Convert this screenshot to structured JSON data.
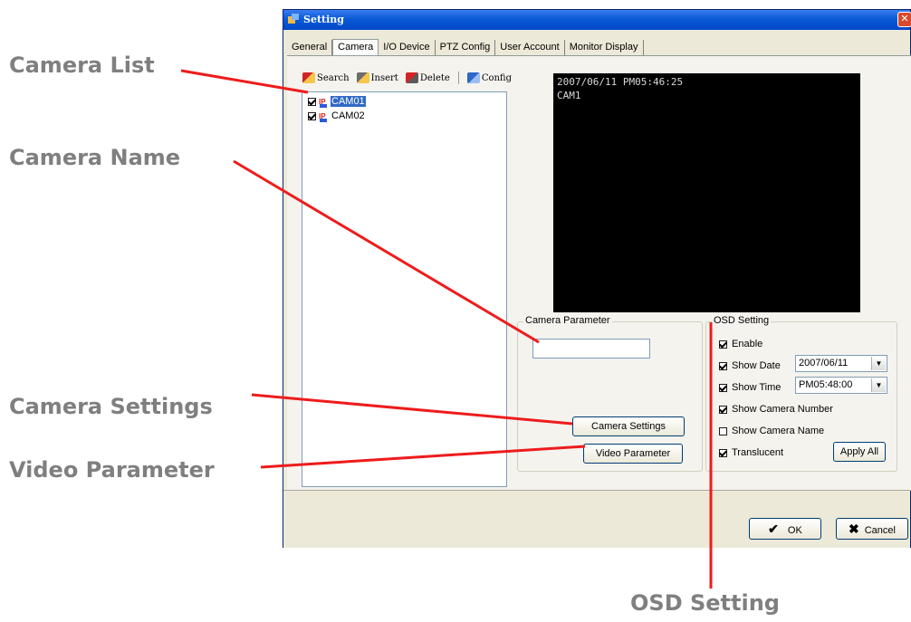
{
  "window": {
    "title": "Setting",
    "close_glyph": "✕",
    "tabs": [
      {
        "label": "General"
      },
      {
        "label": "Camera"
      },
      {
        "label": "I/O Device"
      },
      {
        "label": "PTZ Config"
      },
      {
        "label": "User Account"
      },
      {
        "label": "Monitor Display"
      }
    ],
    "active_tab": "Camera"
  },
  "toolbar": {
    "search_label": "Search",
    "insert_label": "Insert",
    "delete_label": "Delete",
    "config_label": "Config"
  },
  "camera_list": {
    "items": [
      {
        "name": "CAM01",
        "checked": true,
        "selected": true,
        "icon": "ip-camera-icon"
      },
      {
        "name": "CAM02",
        "checked": true,
        "selected": false,
        "icon": "ip-camera-icon"
      }
    ]
  },
  "preview": {
    "osd_line1": "2007/06/11 PM05:46:25",
    "osd_line2": "CAM1"
  },
  "camera_parameter": {
    "title": "Camera Parameter",
    "name_value": "",
    "camera_settings_label": "Camera Settings",
    "video_parameter_label": "Video Parameter"
  },
  "osd_setting": {
    "title": "OSD Setting",
    "enable_label": "Enable",
    "show_date_label": "Show Date",
    "date_value": "2007/06/11",
    "show_time_label": "Show Time",
    "time_value": "PM05:48:00",
    "show_camera_number_label": "Show Camera Number",
    "show_camera_name_label": "Show Camera Name",
    "translucent_label": "Translucent",
    "apply_all_label": "Apply All"
  },
  "dialog_buttons": {
    "ok_label": "OK",
    "cancel_label": "Cancel"
  },
  "annotations": {
    "camera_list": "Camera List",
    "camera_name": "Camera Name",
    "camera_settings": "Camera Settings",
    "video_parameter": "Video Parameter",
    "osd_setting": "OSD Setting"
  },
  "colors": {
    "callout_line": "#ee1c1c",
    "annotation_text": "#7f7f7f",
    "titlebar": "#0a5ad6",
    "preview_bg": "#000000"
  }
}
